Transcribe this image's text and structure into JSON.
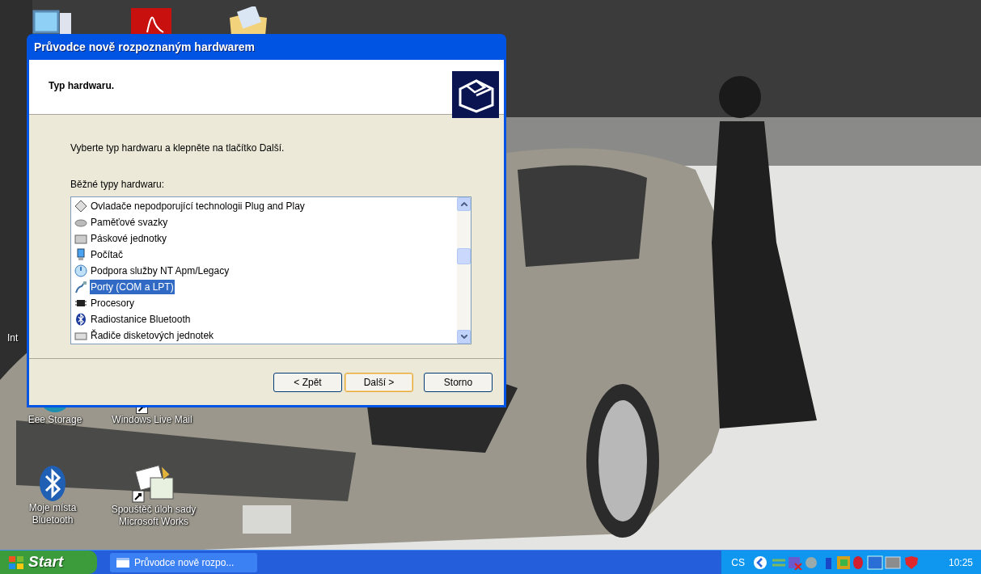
{
  "desktop": {
    "cut_label": "Int",
    "icons": [
      {
        "label": "Eee Storage"
      },
      {
        "label": "Windows Live Mail"
      },
      {
        "label": "Moje místa Bluetooth"
      },
      {
        "label": "Spouštěč úloh sady Microsoft Works"
      }
    ]
  },
  "window": {
    "title": "Průvodce nově rozpoznaným hardwarem",
    "heading": "Typ hardwaru.",
    "instruction": "Vyberte typ hardwaru a klepněte na tlačítko Další.",
    "list_label": "Běžné typy hardwaru:",
    "items": [
      {
        "label": "Ovladače nepodporující technologii Plug and Play",
        "selected": false
      },
      {
        "label": "Paměťové svazky",
        "selected": false
      },
      {
        "label": "Páskové jednotky",
        "selected": false
      },
      {
        "label": "Počítač",
        "selected": false
      },
      {
        "label": "Podpora služby NT Apm/Legacy",
        "selected": false
      },
      {
        "label": "Porty (COM a LPT)",
        "selected": true
      },
      {
        "label": "Procesory",
        "selected": false
      },
      {
        "label": "Radiostanice Bluetooth",
        "selected": false
      },
      {
        "label": "Řadiče disketových jednotek",
        "selected": false
      }
    ],
    "buttons": [
      {
        "label": "< Zpět",
        "default": false
      },
      {
        "label": "Další >",
        "default": true
      },
      {
        "label": "Storno",
        "default": false
      }
    ]
  },
  "taskbar": {
    "start": "Start",
    "tasks": [
      {
        "label": "Průvodce nově rozpo..."
      }
    ],
    "language": "CS",
    "clock": "10:25"
  }
}
